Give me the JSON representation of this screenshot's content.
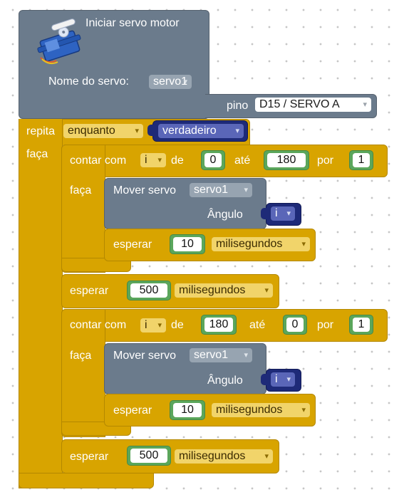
{
  "init_block": {
    "title": "Iniciar servo motor",
    "name_label": "Nome do servo:",
    "servo_name": "servo1",
    "pin_label": "pino",
    "pin_value": "D15 / SERVO A",
    "icon": "servo-motor-icon"
  },
  "loop": {
    "repeat_label": "repita",
    "mode": "enquanto",
    "condition": "verdadeiro",
    "do_label": "faça"
  },
  "for1": {
    "label": "contar com",
    "var": "i",
    "from_label": "de",
    "from": "0",
    "to_label": "até",
    "to": "180",
    "by_label": "por",
    "by": "1",
    "do_label": "faça",
    "move_label": "Mover servo",
    "servo": "servo1",
    "angle_label": "Ângulo",
    "angle_var": "i",
    "wait_label": "esperar",
    "wait_value": "10",
    "wait_unit": "milisegundos"
  },
  "wait1": {
    "label": "esperar",
    "value": "500",
    "unit": "milisegundos"
  },
  "for2": {
    "label": "contar com",
    "var": "i",
    "from_label": "de",
    "from": "180",
    "to_label": "até",
    "to": "0",
    "by_label": "por",
    "by": "1",
    "do_label": "faça",
    "move_label": "Mover servo",
    "servo": "servo1",
    "angle_label": "Ângulo",
    "angle_var": "i",
    "wait_label": "esperar",
    "wait_value": "10",
    "wait_unit": "milisegundos"
  },
  "wait2": {
    "label": "esperar",
    "value": "500",
    "unit": "milisegundos"
  },
  "colors": {
    "servo_block": "#6b7b8c",
    "control_block": "#d8a400",
    "logic_block": "#1e2a78",
    "math_block": "#5ba65b",
    "workspace": "#ffffff"
  }
}
